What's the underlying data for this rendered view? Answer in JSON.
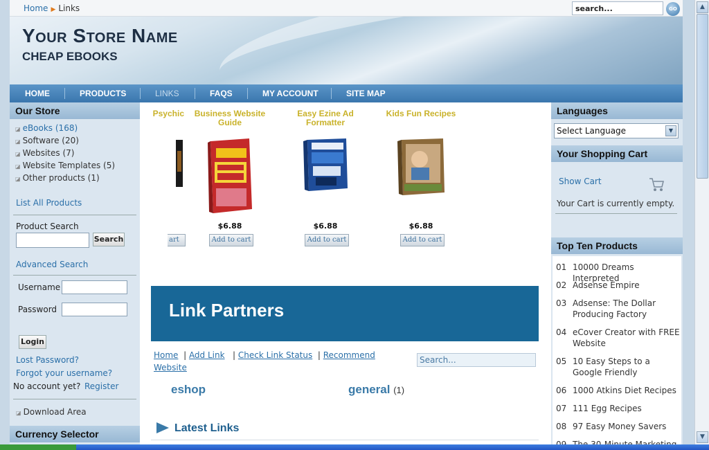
{
  "breadcrumb": {
    "home": "Home",
    "current": "Links"
  },
  "top_search": {
    "value": "search...",
    "go_label": "GO"
  },
  "header": {
    "store_name": "Your Store Name",
    "tagline": "CHEAP EBOOKS"
  },
  "nav": {
    "items": [
      "HOME",
      "PRODUCTS",
      "LINKS",
      "FAQS",
      "MY ACCOUNT",
      "SITE MAP"
    ],
    "active": "LINKS"
  },
  "left": {
    "our_store_title": "Our Store",
    "categories": [
      {
        "label": "eBooks (168)"
      },
      {
        "label": "Software (20)"
      },
      {
        "label": "Websites (7)"
      },
      {
        "label": "Website Templates (5)"
      },
      {
        "label": "Other products (1)"
      }
    ],
    "list_all": "List All Products",
    "product_search_label": "Product Search",
    "search_button": "Search",
    "advanced_search": "Advanced Search",
    "username_label": "Username",
    "password_label": "Password",
    "login_button": "Login",
    "lost_password": "Lost Password?",
    "forgot_username": "Forgot your username?",
    "no_account": "No account yet?",
    "register": "Register",
    "download_area": "Download Area",
    "currency_title": "Currency Selector"
  },
  "products": [
    {
      "title": "Psychic",
      "price": "",
      "add": "art"
    },
    {
      "title": "Business Website Guide",
      "price": "$6.88",
      "add": "Add to cart"
    },
    {
      "title": "Easy Ezine Ad Formatter",
      "price": "$6.88",
      "add": "Add to cart"
    },
    {
      "title": "Kids Fun Recipes",
      "price": "$6.88",
      "add": "Add to cart"
    }
  ],
  "partners": {
    "title": "Link Partners",
    "links": {
      "home": "Home",
      "add": "Add Link",
      "check": "Check Link Status",
      "recommend": "Recommend Website"
    },
    "search_placeholder": "Search...",
    "cat_eshop": "eshop",
    "cat_general": "general",
    "cat_general_count": "(1)",
    "latest": "Latest Links"
  },
  "right": {
    "languages_title": "Languages",
    "language_select": "Select Language",
    "cart_title": "Your Shopping Cart",
    "show_cart": "Show Cart",
    "cart_empty": "Your Cart is currently empty.",
    "topten_title": "Top Ten Products",
    "topten": [
      {
        "n": "01",
        "t": "10000 Dreams Interpreted"
      },
      {
        "n": "02",
        "t": "Adsense Empire"
      },
      {
        "n": "03",
        "t": "Adsense: The Dollar Producing Factory"
      },
      {
        "n": "04",
        "t": "eCover Creator with FREE Website"
      },
      {
        "n": "05",
        "t": "10 Easy Steps to a Google Friendly"
      },
      {
        "n": "06",
        "t": "1000 Atkins Diet Recipes"
      },
      {
        "n": "07",
        "t": "111 Egg Recipes"
      },
      {
        "n": "08",
        "t": "97 Easy Money Savers"
      },
      {
        "n": "09",
        "t": "The 30-Minute Marketing"
      }
    ]
  },
  "colors": {
    "nav": "#3a76ad",
    "partners_banner": "#186797",
    "product_title": "#c9b22a",
    "link": "#2a6fa8"
  }
}
